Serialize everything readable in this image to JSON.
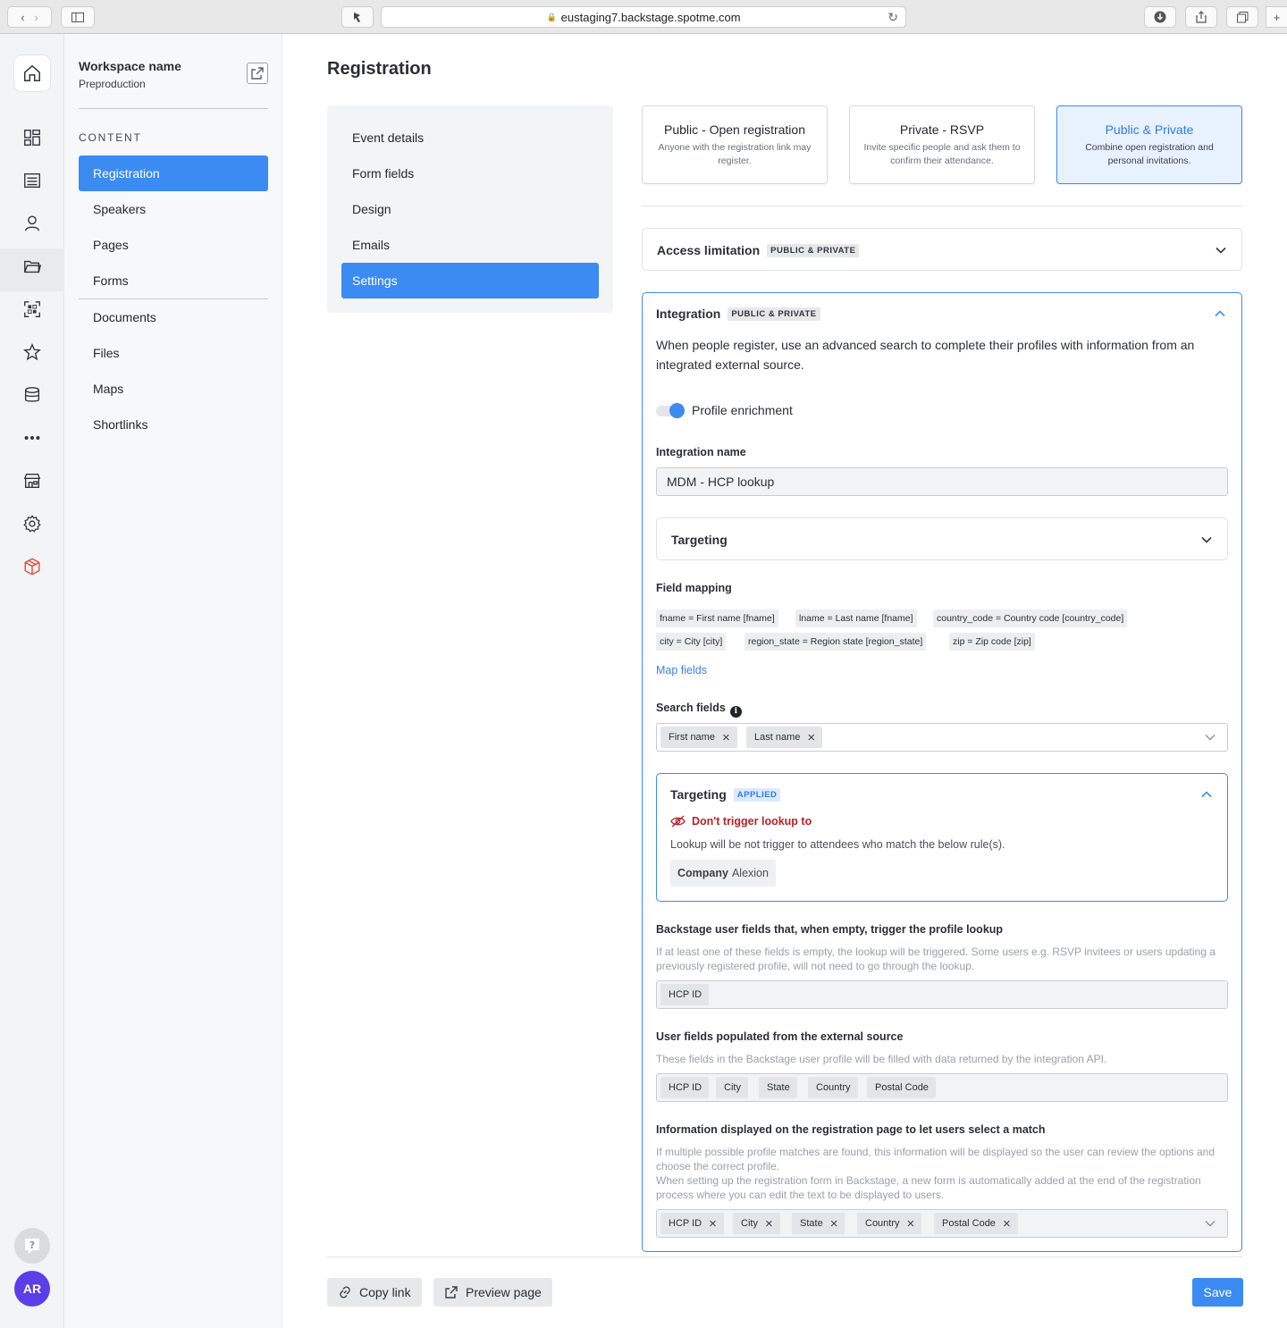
{
  "browser": {
    "url": "eustaging7.backstage.spotme.com"
  },
  "rail": {
    "icons": [
      "home-icon",
      "dashboard-icon",
      "list-icon",
      "user-icon",
      "folder-icon",
      "qr-code-icon",
      "star-icon",
      "database-icon",
      "more-icon",
      "store-icon",
      "gear-icon",
      "cube-icon"
    ],
    "avatar_initials": "AR"
  },
  "workspace": {
    "name": "Workspace name",
    "subtitle": "Preproduction"
  },
  "sidebar": {
    "section_title": "CONTENT",
    "items": [
      "Registration",
      "Speakers",
      "Pages",
      "Forms"
    ],
    "items2": [
      "Documents",
      "Files",
      "Maps",
      "Shortlinks"
    ]
  },
  "page": {
    "title": "Registration"
  },
  "subnav": {
    "items": [
      "Event details",
      "Form fields",
      "Design",
      "Emails",
      "Settings"
    ]
  },
  "reg_types": [
    {
      "title": "Public - Open registration",
      "desc": "Anyone with the registration link may register."
    },
    {
      "title": "Private - RSVP",
      "desc": "Invite specific people and ask them to confirm their attendance."
    },
    {
      "title": "Public & Private",
      "desc": "Combine open registration and personal invitations."
    }
  ],
  "access": {
    "title": "Access limitation",
    "badge": "PUBLIC & PRIVATE"
  },
  "integration": {
    "title": "Integration",
    "badge": "PUBLIC & PRIVATE",
    "description": "When people register, use an advanced search to complete their profiles with information from an integrated external source.",
    "toggle_label": "Profile enrichment",
    "name_label": "Integration name",
    "name_value": "MDM - HCP lookup",
    "targeting_title": "Targeting",
    "field_mapping_label": "Field mapping",
    "mappings": [
      "fname = First name [fname]",
      "lname = Last name [fname]",
      "country_code = Country code [country_code]",
      "city = City [city]",
      "region_state = Region state [region_state]",
      "zip = Zip code [zip]"
    ],
    "map_fields_link": "Map fields",
    "search_fields_label": "Search fields",
    "search_fields": [
      "First name",
      "Last name"
    ],
    "targeting_applied": {
      "title": "Targeting",
      "badge": "APPLIED",
      "warning": "Don't trigger lookup to",
      "desc": "Lookup will be not trigger to attendees who match the below rule(s).",
      "rule_field": "Company",
      "rule_value": "Alexion"
    },
    "empty_trigger": {
      "label": "Backstage user fields that, when empty, trigger the profile lookup",
      "hint": "If at least one of these fields is empty, the lookup will be triggered. Some users e.g. RSVP invitees or users updating a previously registered profile, will not need to go through the lookup.",
      "fields": [
        "HCP ID"
      ]
    },
    "populated": {
      "label": "User fields populated from the external source",
      "hint": "These fields in the Backstage user profile will be filled with data returned by the integration API.",
      "fields": [
        "HCP ID",
        "City",
        "State",
        "Country",
        "Postal Code"
      ]
    },
    "displayed": {
      "label": "Information displayed on the registration page to let users select a match",
      "hint1": "If multiple possible profile matches are found, this information will be displayed so the user can review the options and choose the correct profile.",
      "hint2": "When setting up the registration form in Backstage, a new form is automatically added at the end of the registration process where you can edit the text to be displayed to users.",
      "fields": [
        "HCP ID",
        "City",
        "State",
        "Country",
        "Postal Code"
      ]
    }
  },
  "footer": {
    "copy_link": "Copy link",
    "preview_page": "Preview page",
    "save": "Save"
  }
}
